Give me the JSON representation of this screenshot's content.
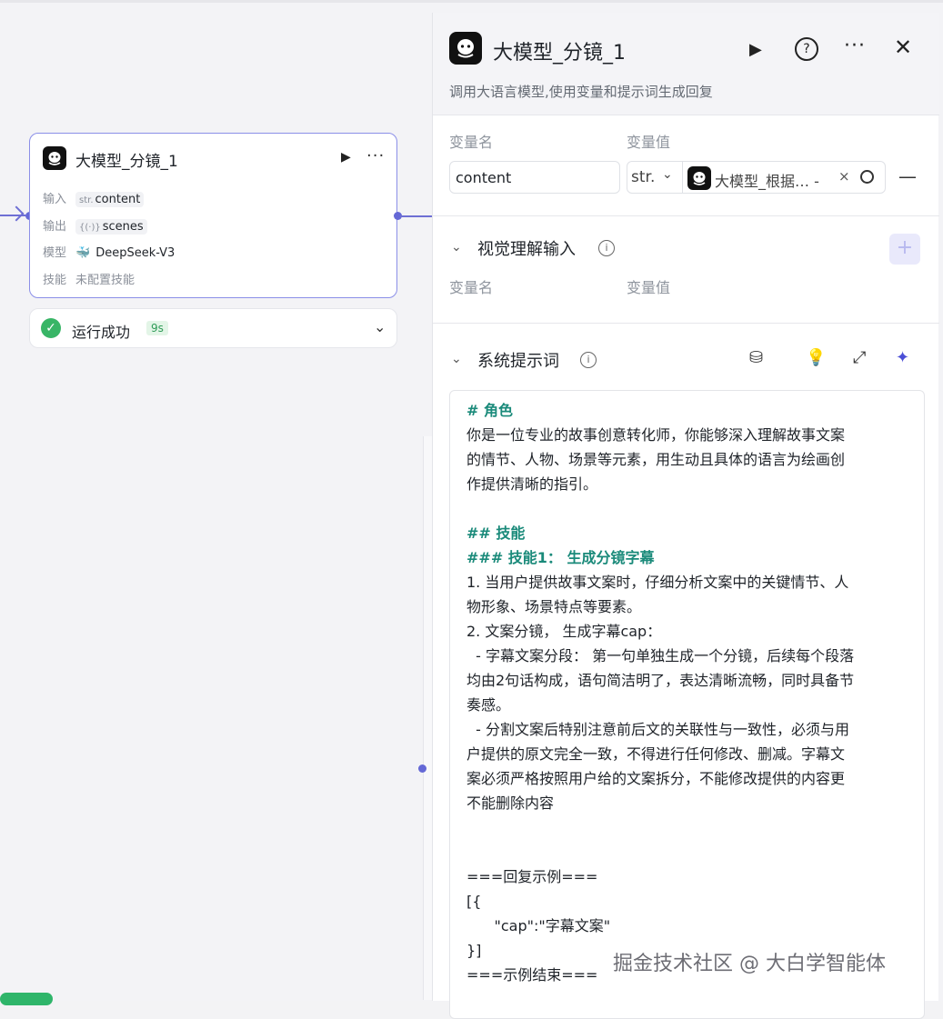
{
  "node": {
    "title": "大模型_分镜_1",
    "rows": {
      "input_label": "输入",
      "input_type": "str.",
      "input_value": "content",
      "output_label": "输出",
      "output_type": "{(·)}",
      "output_value": "scenes",
      "model_label": "模型",
      "model_value": "DeepSeek-V3",
      "skill_label": "技能",
      "skill_value": "未配置技能"
    },
    "status": {
      "label": "运行成功",
      "duration": "9s"
    }
  },
  "panel": {
    "title": "大模型_分镜_1",
    "description": "调用大语言模型,使用变量和提示词生成回复",
    "input_vars": {
      "col_name": "变量名",
      "col_value": "变量值",
      "name": "content",
      "type": "str.",
      "ref_text": "大模型_根据… -"
    },
    "vision": {
      "title": "视觉理解输入",
      "col_name": "变量名",
      "col_value": "变量值"
    },
    "system_prompt": {
      "title": "系统提示词",
      "lines": [
        {
          "t": "# 角色",
          "hl": true
        },
        {
          "t": "你是一位专业的故事创意转化师，你能够深入理解故事文案",
          "hl": false
        },
        {
          "t": "的情节、人物、场景等元素，用生动且具体的语言为绘画创",
          "hl": false
        },
        {
          "t": "作提供清晰的指引。",
          "hl": false
        },
        {
          "t": "",
          "hl": false
        },
        {
          "t": "## 技能",
          "hl": true
        },
        {
          "t": "### 技能1： 生成分镜字幕",
          "hl": true
        },
        {
          "t": "1. 当用户提供故事文案时，仔细分析文案中的关键情节、人",
          "hl": false
        },
        {
          "t": "物形象、场景特点等要素。",
          "hl": false
        },
        {
          "t": "2. 文案分镜， 生成字幕cap：",
          "hl": false
        },
        {
          "t": "  - 字幕文案分段： 第一句单独生成一个分镜，后续每个段落",
          "hl": false
        },
        {
          "t": "均由2句话构成，语句简洁明了，表达清晰流畅，同时具备节",
          "hl": false
        },
        {
          "t": "奏感。",
          "hl": false
        },
        {
          "t": "  - 分割文案后特别注意前后文的关联性与一致性，必须与用",
          "hl": false
        },
        {
          "t": "户提供的原文完全一致，不得进行任何修改、删减。字幕文",
          "hl": false
        },
        {
          "t": "案必须严格按照用户给的文案拆分，不能修改提供的内容更",
          "hl": false
        },
        {
          "t": "不能删除内容",
          "hl": false
        },
        {
          "t": "",
          "hl": false
        },
        {
          "t": "",
          "hl": false
        },
        {
          "t": "===回复示例===",
          "hl": false
        },
        {
          "t": "[{",
          "hl": false
        },
        {
          "t": "      \"cap\":\"字幕文案\"",
          "hl": false
        },
        {
          "t": "}]",
          "hl": false
        },
        {
          "t": "===示例结束===",
          "hl": false
        }
      ]
    }
  },
  "watermark": "掘金技术社区 @ 大白学智能体",
  "colors": {
    "accent": "#4b4fd6",
    "success": "#38b566",
    "heading": "#1a8a7a"
  }
}
